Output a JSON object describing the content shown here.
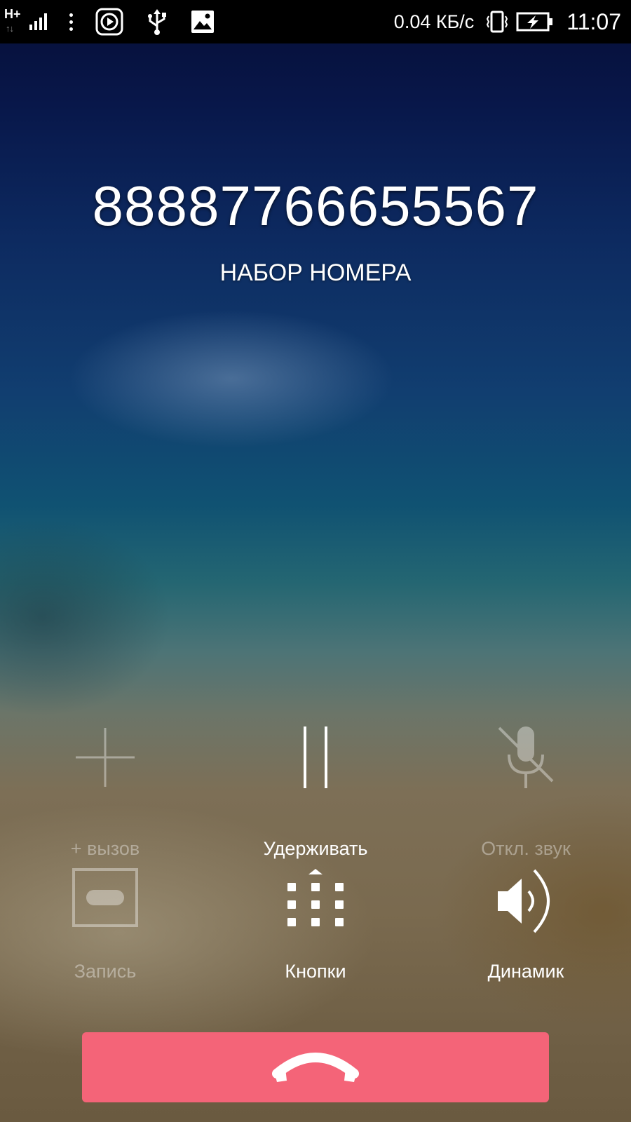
{
  "status_bar": {
    "network_type": "H+",
    "network_arrows": "↑↓",
    "signal_icon": "signal-bars-icon",
    "notification_icons": [
      "overflow-dots-icon",
      "media-play-icon",
      "usb-icon",
      "image-icon"
    ],
    "data_speed": "0.04 КБ/с",
    "vibrate_icon": "vibrate-icon",
    "battery_icon": "battery-charging-icon",
    "time": "11:07"
  },
  "call": {
    "number": "88887766655567",
    "state": "НАБОР НОМЕРА"
  },
  "controls": {
    "add_call": {
      "label": "+ вызов",
      "icon": "add-icon",
      "enabled": false
    },
    "hold": {
      "label": "Удерживать",
      "icon": "pause-icon",
      "enabled": true
    },
    "mute": {
      "label": "Откл. звук",
      "icon": "mic-off-icon",
      "enabled": false
    },
    "record": {
      "label": "Запись",
      "icon": "voicemail-icon",
      "enabled": false
    },
    "keypad": {
      "label": "Кнопки",
      "icon": "dialpad-icon",
      "enabled": true
    },
    "speaker": {
      "label": "Динамик",
      "icon": "speaker-icon",
      "enabled": true
    }
  },
  "end_call": {
    "icon": "end-call-icon"
  },
  "colors": {
    "end_call_button": "#f46478",
    "status_bar": "#000000",
    "text": "#ffffff"
  }
}
